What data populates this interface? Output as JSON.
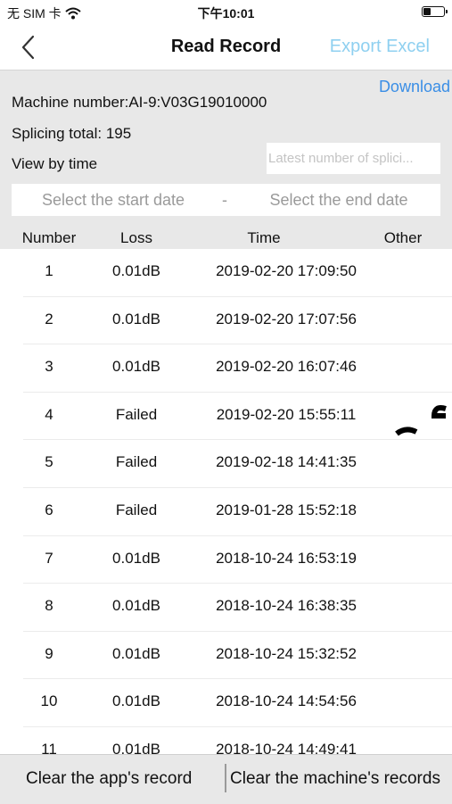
{
  "status_bar": {
    "carrier": "无 SIM 卡",
    "time": "下午10:01"
  },
  "nav": {
    "title": "Read Record",
    "export_label": "Export Excel"
  },
  "info": {
    "download_label": "Download",
    "machine_number": "Machine number:AI-9:V03G19010000",
    "splicing_total": "Splicing total:  195",
    "view_by_time": "View by time",
    "latest_placeholder": "Latest number of splici...",
    "start_date_placeholder": "Select the start date",
    "date_separator": "-",
    "end_date_placeholder": "Select the end date"
  },
  "table": {
    "headers": {
      "number": "Number",
      "loss": "Loss",
      "time": "Time",
      "other": "Other"
    },
    "rows": [
      {
        "number": "1",
        "loss": "0.01dB",
        "time": "2019-02-20 17:09:50"
      },
      {
        "number": "2",
        "loss": "0.01dB",
        "time": "2019-02-20 17:07:56"
      },
      {
        "number": "3",
        "loss": "0.01dB",
        "time": "2019-02-20 16:07:46"
      },
      {
        "number": "4",
        "loss": "Failed",
        "time": "2019-02-20 15:55:11"
      },
      {
        "number": "5",
        "loss": "Failed",
        "time": "2019-02-18 14:41:35"
      },
      {
        "number": "6",
        "loss": "Failed",
        "time": "2019-01-28 15:52:18"
      },
      {
        "number": "7",
        "loss": "0.01dB",
        "time": "2018-10-24 16:53:19"
      },
      {
        "number": "8",
        "loss": "0.01dB",
        "time": "2018-10-24 16:38:35"
      },
      {
        "number": "9",
        "loss": "0.01dB",
        "time": "2018-10-24 15:32:52"
      },
      {
        "number": "10",
        "loss": "0.01dB",
        "time": "2018-10-24 14:54:56"
      },
      {
        "number": "11",
        "loss": "0.01dB",
        "time": "2018-10-24 14:49:41"
      }
    ]
  },
  "footer": {
    "clear_app_label": "Clear the app's record",
    "clear_machine_label": "Clear the machine's records"
  },
  "colors": {
    "accent_light": "#8fd0f0",
    "link": "#3a8ee6",
    "panel_bg": "#e8e8e8"
  }
}
